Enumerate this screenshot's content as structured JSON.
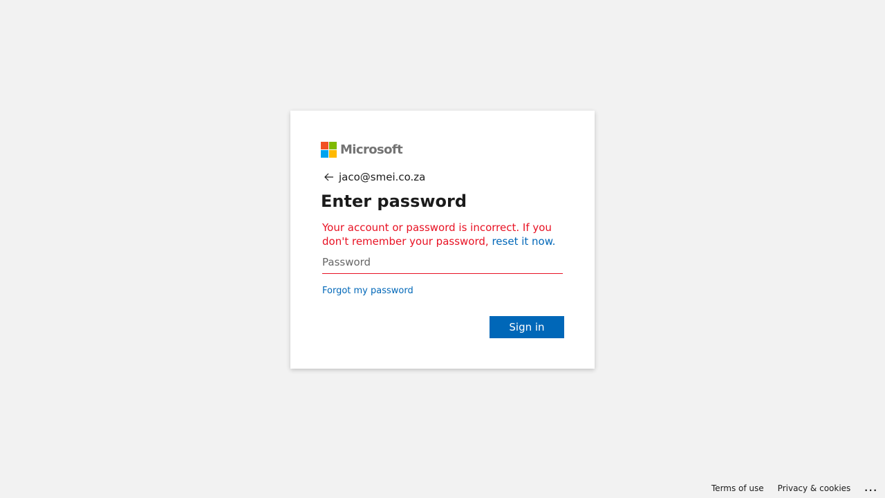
{
  "brand": {
    "name": "Microsoft",
    "logo_colors": [
      "#f25022",
      "#7fba00",
      "#00a4ef",
      "#ffb900"
    ]
  },
  "identity": {
    "back_icon": "arrow-left-icon",
    "email": "jaco@smei.co.za"
  },
  "title": "Enter password",
  "error": {
    "message": "Your account or password is incorrect. If you don't remember your password,",
    "reset_link": "reset it now.",
    "color": "#e81123"
  },
  "password": {
    "value": "",
    "placeholder": "Password"
  },
  "forgot_link": "Forgot my password",
  "sign_in_label": "Sign in",
  "accent_color": "#0067b8",
  "footer": {
    "terms": "Terms of use",
    "privacy": "Privacy & cookies",
    "more": "..."
  }
}
